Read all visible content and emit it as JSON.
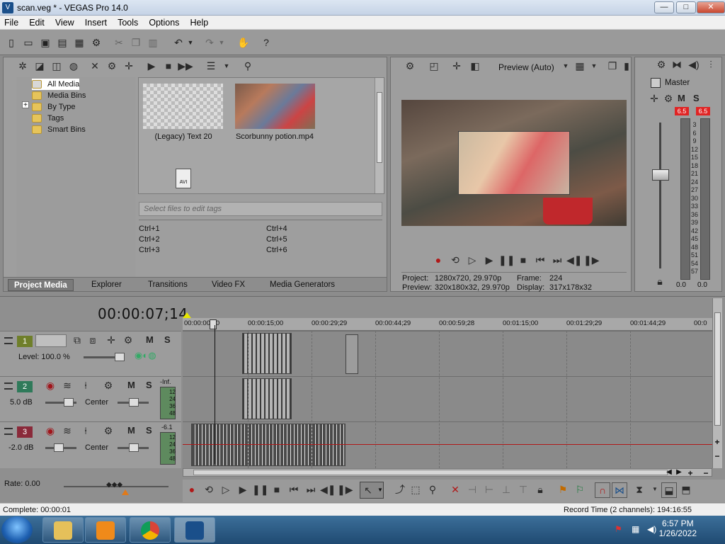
{
  "window": {
    "title": "scan.veg * - VEGAS Pro 14.0",
    "minimize": "—",
    "maximize": "□",
    "close": "✕"
  },
  "menu": [
    "File",
    "Edit",
    "View",
    "Insert",
    "Tools",
    "Options",
    "Help"
  ],
  "media": {
    "tree": [
      "All Media",
      "Media Bins",
      "By Type",
      "Tags",
      "Smart Bins"
    ],
    "tree_expand": "+",
    "items": [
      "(Legacy) Text 20",
      "Scorbunny potion.mp4"
    ],
    "avi_label": "AVI",
    "tag_placeholder": "Select files to edit tags",
    "hotkeys": [
      "Ctrl+1",
      "Ctrl+2",
      "Ctrl+3",
      "Ctrl+4",
      "Ctrl+5",
      "Ctrl+6"
    ],
    "tabs": [
      "Project Media",
      "Explorer",
      "Transitions",
      "Video FX",
      "Media Generators"
    ]
  },
  "preview": {
    "mode": "Preview (Auto)",
    "project_label": "Project:",
    "project_value": "1280x720, 29.970p",
    "preview_label": "Preview:",
    "preview_value": "320x180x32, 29.970p",
    "frame_label": "Frame:",
    "frame_value": "224",
    "display_label": "Display:",
    "display_value": "317x178x32"
  },
  "mixer": {
    "title": "Master",
    "peak_left": "6.5",
    "peak_right": "6.5",
    "scale": [
      "3",
      "6",
      "9",
      "12",
      "15",
      "18",
      "21",
      "24",
      "27",
      "30",
      "33",
      "36",
      "39",
      "42",
      "45",
      "48",
      "51",
      "54",
      "57"
    ],
    "level_left": "0.0",
    "level_right": "0.0",
    "mute_label": "M",
    "solo_label": "S"
  },
  "timeline": {
    "timecode": "00:00:07;14",
    "ruler": [
      "00:00:00;00",
      "00:00:15;00",
      "00:00:29;29",
      "00:00:44;29",
      "00:00:59;28",
      "00:01:15;00",
      "00:01:29;29",
      "00:01:44;29",
      "00:0"
    ],
    "tracks": [
      {
        "num": "1",
        "label": "Level: 100.0 %",
        "color": "#6f7f2a"
      },
      {
        "num": "2",
        "label": "5.0 dB",
        "pan": "Center",
        "color": "#2f7a5a",
        "inf": "-Inf."
      },
      {
        "num": "3",
        "label": "-2.0 dB",
        "pan": "Center",
        "color": "#8a2a3a",
        "inf": "-6.1"
      }
    ],
    "meter_ticks": [
      "12",
      "24",
      "36",
      "48"
    ],
    "mute_label": "M",
    "solo_label": "S",
    "rate": "Rate: 0.00"
  },
  "status": {
    "left": "Complete: 00:00:01",
    "right": "Record Time (2 channels): 194:16:55"
  },
  "taskbar": {
    "time": "6:57 PM",
    "date": "1/26/2022"
  },
  "colors": {
    "accent": "#1a4f8a",
    "peak": "#e02424",
    "track1": "#6f7f2a",
    "track2": "#2f7a5a",
    "track3": "#8a2a3a"
  }
}
